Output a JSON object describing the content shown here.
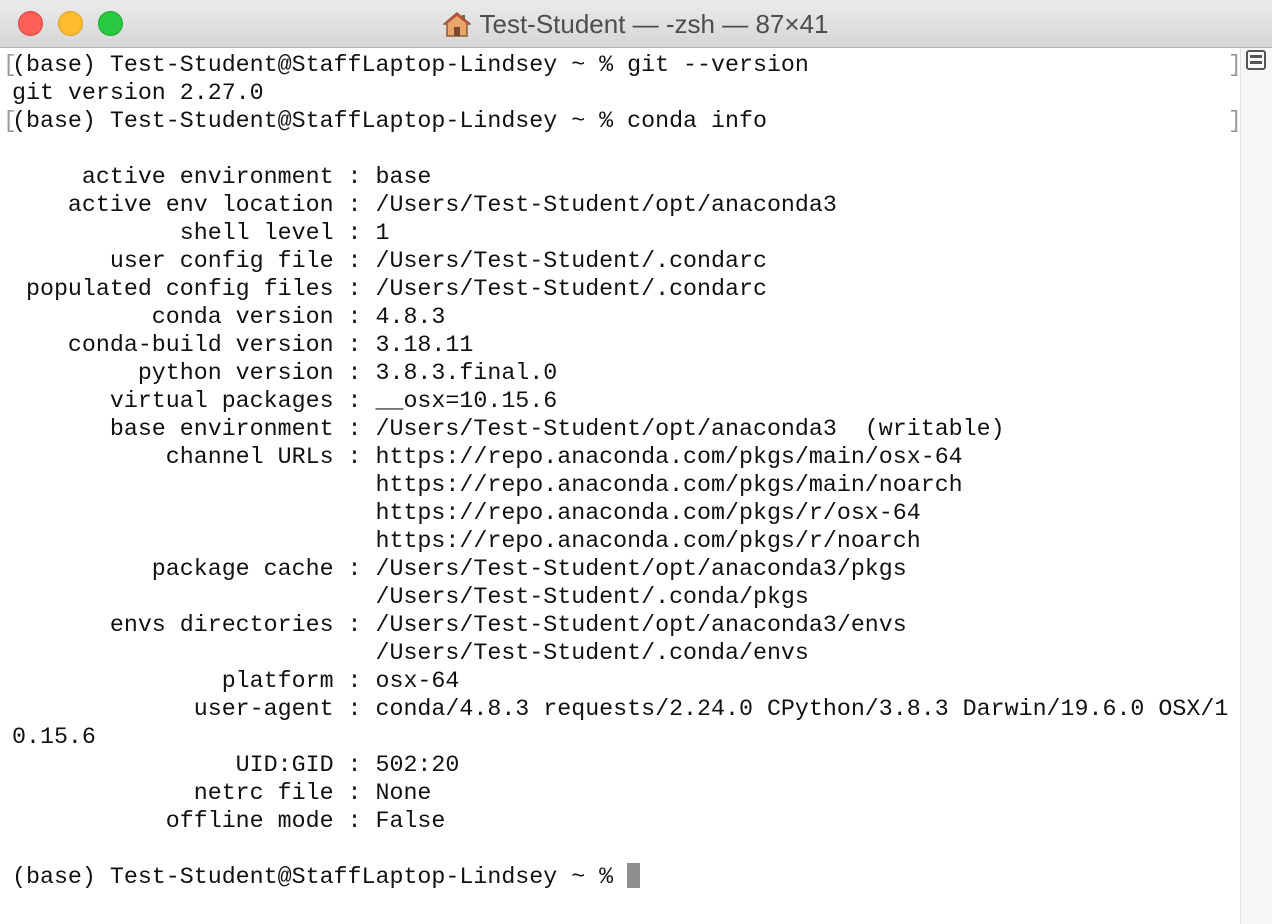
{
  "window": {
    "title": "Test-Student — -zsh — 87×41"
  },
  "terminal": {
    "lines": [
      "(base) Test-Student@StaffLaptop-Lindsey ~ % git --version",
      "git version 2.27.0",
      "(base) Test-Student@StaffLaptop-Lindsey ~ % conda info",
      "",
      "     active environment : base",
      "    active env location : /Users/Test-Student/opt/anaconda3",
      "            shell level : 1",
      "       user config file : /Users/Test-Student/.condarc",
      " populated config files : /Users/Test-Student/.condarc",
      "          conda version : 4.8.3",
      "    conda-build version : 3.18.11",
      "         python version : 3.8.3.final.0",
      "       virtual packages : __osx=10.15.6",
      "       base environment : /Users/Test-Student/opt/anaconda3  (writable)",
      "           channel URLs : https://repo.anaconda.com/pkgs/main/osx-64",
      "                          https://repo.anaconda.com/pkgs/main/noarch",
      "                          https://repo.anaconda.com/pkgs/r/osx-64",
      "                          https://repo.anaconda.com/pkgs/r/noarch",
      "          package cache : /Users/Test-Student/opt/anaconda3/pkgs",
      "                          /Users/Test-Student/.conda/pkgs",
      "       envs directories : /Users/Test-Student/opt/anaconda3/envs",
      "                          /Users/Test-Student/.conda/envs",
      "               platform : osx-64",
      "             user-agent : conda/4.8.3 requests/2.24.0 CPython/3.8.3 Darwin/19.6.0 OSX/1",
      "0.15.6",
      "                UID:GID : 502:20",
      "             netrc file : None",
      "           offline mode : False",
      "",
      "(base) Test-Student@StaffLaptop-Lindsey ~ % "
    ],
    "marked_lines": [
      0,
      2
    ]
  },
  "icons": {
    "title": "house-icon",
    "split": "split-pane-icon"
  },
  "colors": {
    "close": "#fe5f57",
    "minimize": "#febc2e",
    "zoom": "#28c840"
  }
}
